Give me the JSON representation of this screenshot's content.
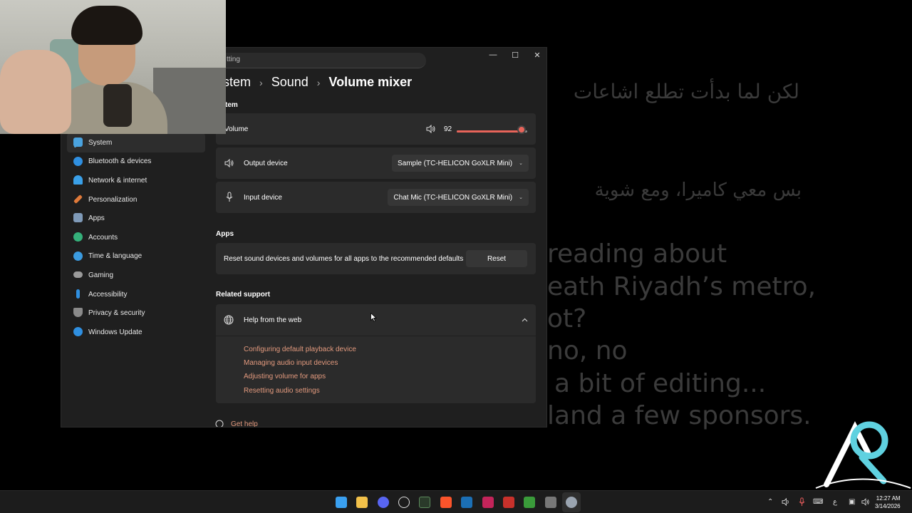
{
  "background_slide": {
    "arabic_line_1": "لكن لما بدأت تطلع اشاعات",
    "arabic_line_2": "بس معي كاميرا، ومع شوية",
    "english_lines": [
      "reading about",
      "eath Riyadh’s metro,",
      "ot?",
      "no, no",
      "a bit of editing...",
      "land a few sponsors."
    ]
  },
  "window": {
    "search_text": "tting",
    "controls": {
      "minimize": "—",
      "maximize": "☐",
      "close": "✕"
    },
    "breadcrumb": {
      "part1": "ystem",
      "part2": "Sound",
      "current": "Volume mixer",
      "separator": "›"
    }
  },
  "sidebar": {
    "items": [
      {
        "label": "System",
        "icon": "system-icon",
        "color": "#4aa3df"
      },
      {
        "label": "Bluetooth & devices",
        "icon": "bluetooth-icon",
        "color": "#2f8fe0"
      },
      {
        "label": "Network & internet",
        "icon": "wifi-icon",
        "color": "#3aa0e8"
      },
      {
        "label": "Personalization",
        "icon": "brush-icon",
        "color": "#e07a3a"
      },
      {
        "label": "Apps",
        "icon": "apps-icon",
        "color": "#7f9ab8"
      },
      {
        "label": "Accounts",
        "icon": "accounts-icon",
        "color": "#35b07a"
      },
      {
        "label": "Time & language",
        "icon": "globe-clock-icon",
        "color": "#3b9be0"
      },
      {
        "label": "Gaming",
        "icon": "gamepad-icon",
        "color": "#9a9a9a"
      },
      {
        "label": "Accessibility",
        "icon": "accessibility-icon",
        "color": "#2f8fe0"
      },
      {
        "label": "Privacy & security",
        "icon": "shield-icon",
        "color": "#8a8a8a"
      },
      {
        "label": "Windows Update",
        "icon": "update-icon",
        "color": "#2f8fe0"
      }
    ]
  },
  "system_section": {
    "label": "tem",
    "volume_label": "Volume",
    "volume_value": "92",
    "volume_fraction": 0.92,
    "output_label": "Output device",
    "output_value": "Sample (TC-HELICON GoXLR Mini)",
    "input_label": "Input device",
    "input_value": "Chat Mic (TC-HELICON GoXLR Mini)"
  },
  "apps_section": {
    "label": "Apps",
    "reset_text": "Reset sound devices and volumes for all apps to the recommended defaults",
    "reset_button": "Reset"
  },
  "related_section": {
    "label": "Related support",
    "help_label": "Help from the web",
    "links": [
      "Configuring default playback device",
      "Managing audio input devices",
      "Adjusting volume for apps",
      "Resetting audio settings"
    ],
    "get_help": "Get help"
  },
  "taskbar": {
    "apps": [
      "windows-start-icon",
      "file-explorer-icon",
      "discord-icon",
      "chatgpt-icon",
      "xbox-icon",
      "brave-icon",
      "steam-icon",
      "affinity-icon",
      "libreoffice-icon",
      "minecraft-icon",
      "keyboard-tool-icon",
      "settings-icon"
    ],
    "tray_keyboard": "ع",
    "time": "12:27 AM",
    "date": "3/14/2026"
  },
  "colors": {
    "accent": "#e8645a",
    "link": "#e39a7e",
    "active_nav": "#60a5c8"
  }
}
